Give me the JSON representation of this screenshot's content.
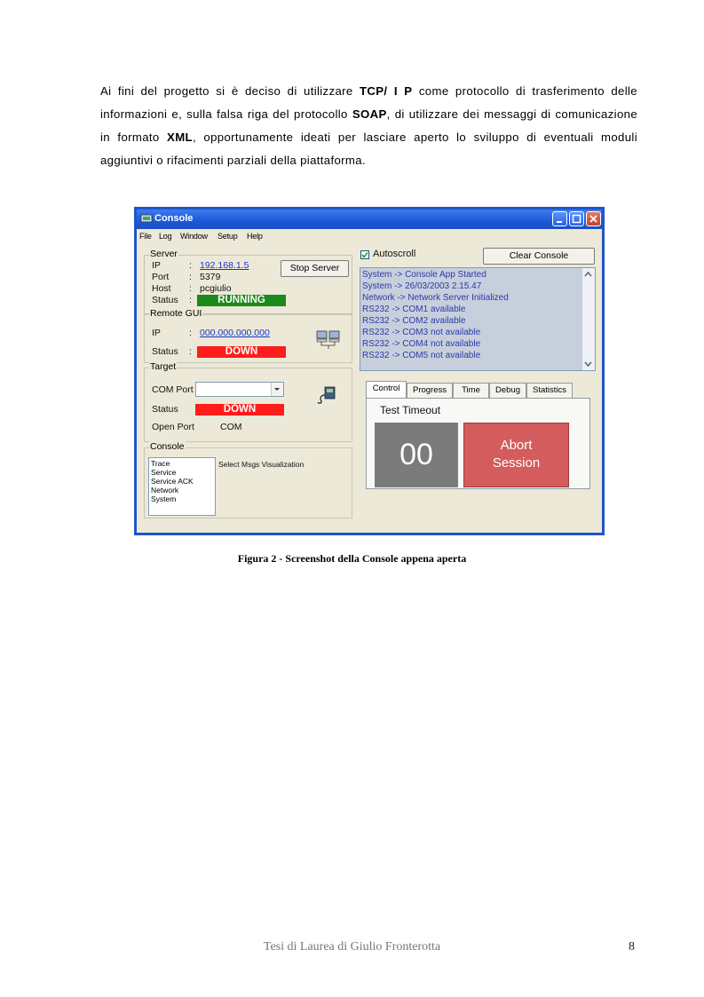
{
  "paragraph": {
    "p1": "Ai fini del progetto si è deciso di utilizzare ",
    "b1": "TCP/ I P",
    "p2": " come protocollo di trasferimento delle informazioni e, sulla falsa riga del protocollo ",
    "b2": "SOAP",
    "p3": ", di utilizzare dei messaggi di comunicazione in formato ",
    "b3": "XML",
    "p4": ", opportunamente ideati per lasciare aperto lo sviluppo di eventuali moduli aggiuntivi o rifacimenti parziali della piattaforma."
  },
  "window": {
    "title": "Console",
    "menu": [
      "File",
      "Log",
      "Window",
      "Setup",
      "Help"
    ],
    "server": {
      "label": "Server",
      "ip_label": "IP",
      "ip_value": "192.168.1.5",
      "port_label": "Port",
      "port_value": "5379",
      "host_label": "Host",
      "host_value": "pcgiulio",
      "status_label": "Status",
      "status_value": "RUNNING",
      "stop_button": "Stop Server",
      "colon": ":"
    },
    "remote_gui": {
      "label": "Remote GUI",
      "ip_label": "IP",
      "ip_value": "000.000.000.000",
      "status_label": "Status",
      "status_value": "DOWN",
      "colon": ":"
    },
    "target": {
      "label": "Target",
      "com_port_label": "COM Port",
      "status_label": "Status",
      "status_value": "DOWN",
      "open_port_label": "Open Port",
      "open_port_value": "COM"
    },
    "console_group": {
      "label": "Console",
      "options": [
        "Trace",
        "Service",
        "Service ACK",
        "Network",
        "System"
      ],
      "hint": "Select Msgs Visualization"
    },
    "autoscroll_label": "Autoscroll",
    "clear_button": "Clear Console",
    "console_lines": [
      "System  -> Console App Started",
      "System  -> 26/03/2003 2.15.47",
      "Network -> Network Server Initialized",
      "RS232   -> COM1 available",
      "RS232   -> COM2 available",
      "RS232   -> COM3 not available",
      "RS232   -> COM4 not available",
      "RS232   -> COM5 not available"
    ],
    "tabs": [
      "Control",
      "Progress",
      "Time",
      "Debug",
      "Statistics"
    ],
    "control": {
      "timeout_label": "Test Timeout",
      "timeout_value": "00",
      "abort_line1": "Abort",
      "abort_line2": "Session"
    },
    "colors": {
      "running": "#1a8a1a",
      "down": "#ff1c1c",
      "abort": "#d45c5c",
      "timer": "#7b7b7b"
    }
  },
  "caption": "Figura 2 - Screenshot della Console appena aperta",
  "footer": "Tesi di Laurea di Giulio Fronterotta",
  "page_number": "8"
}
